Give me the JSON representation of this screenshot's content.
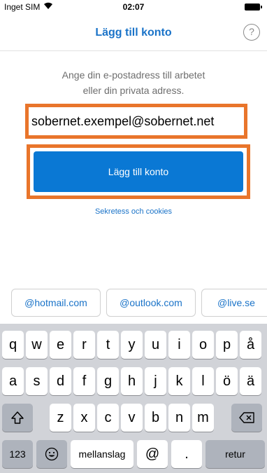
{
  "status_bar": {
    "carrier": "Inget SIM",
    "time": "02:07"
  },
  "nav": {
    "title": "Lägg till konto",
    "help_label": "?"
  },
  "instructions": {
    "line1": "Ange din e-postadress till arbetet",
    "line2": "eller din privata adress."
  },
  "email": {
    "value": "sobernet.exempel@sobernet.net"
  },
  "add_button": {
    "label": "Lägg till konto"
  },
  "privacy_link": {
    "label": "Sekretess och cookies"
  },
  "suggestions": [
    "@hotmail.com",
    "@outlook.com",
    "@live.se"
  ],
  "keyboard": {
    "row1": [
      "q",
      "w",
      "e",
      "r",
      "t",
      "y",
      "u",
      "i",
      "o",
      "p",
      "å"
    ],
    "row2": [
      "a",
      "s",
      "d",
      "f",
      "g",
      "h",
      "j",
      "k",
      "l",
      "ö",
      "ä"
    ],
    "row3": [
      "z",
      "x",
      "c",
      "v",
      "b",
      "n",
      "m"
    ],
    "numbers_label": "123",
    "space_label": "mellanslag",
    "at_label": "@",
    "period_label": ".",
    "return_label": "retur"
  },
  "colors": {
    "accent": "#0a78d4",
    "highlight": "#e9752b",
    "link": "#1a73c8"
  },
  "icons": {
    "wifi": "wifi-icon",
    "battery": "battery-icon",
    "shift": "shift-icon",
    "backspace": "backspace-icon",
    "emoji": "emoji-icon"
  }
}
